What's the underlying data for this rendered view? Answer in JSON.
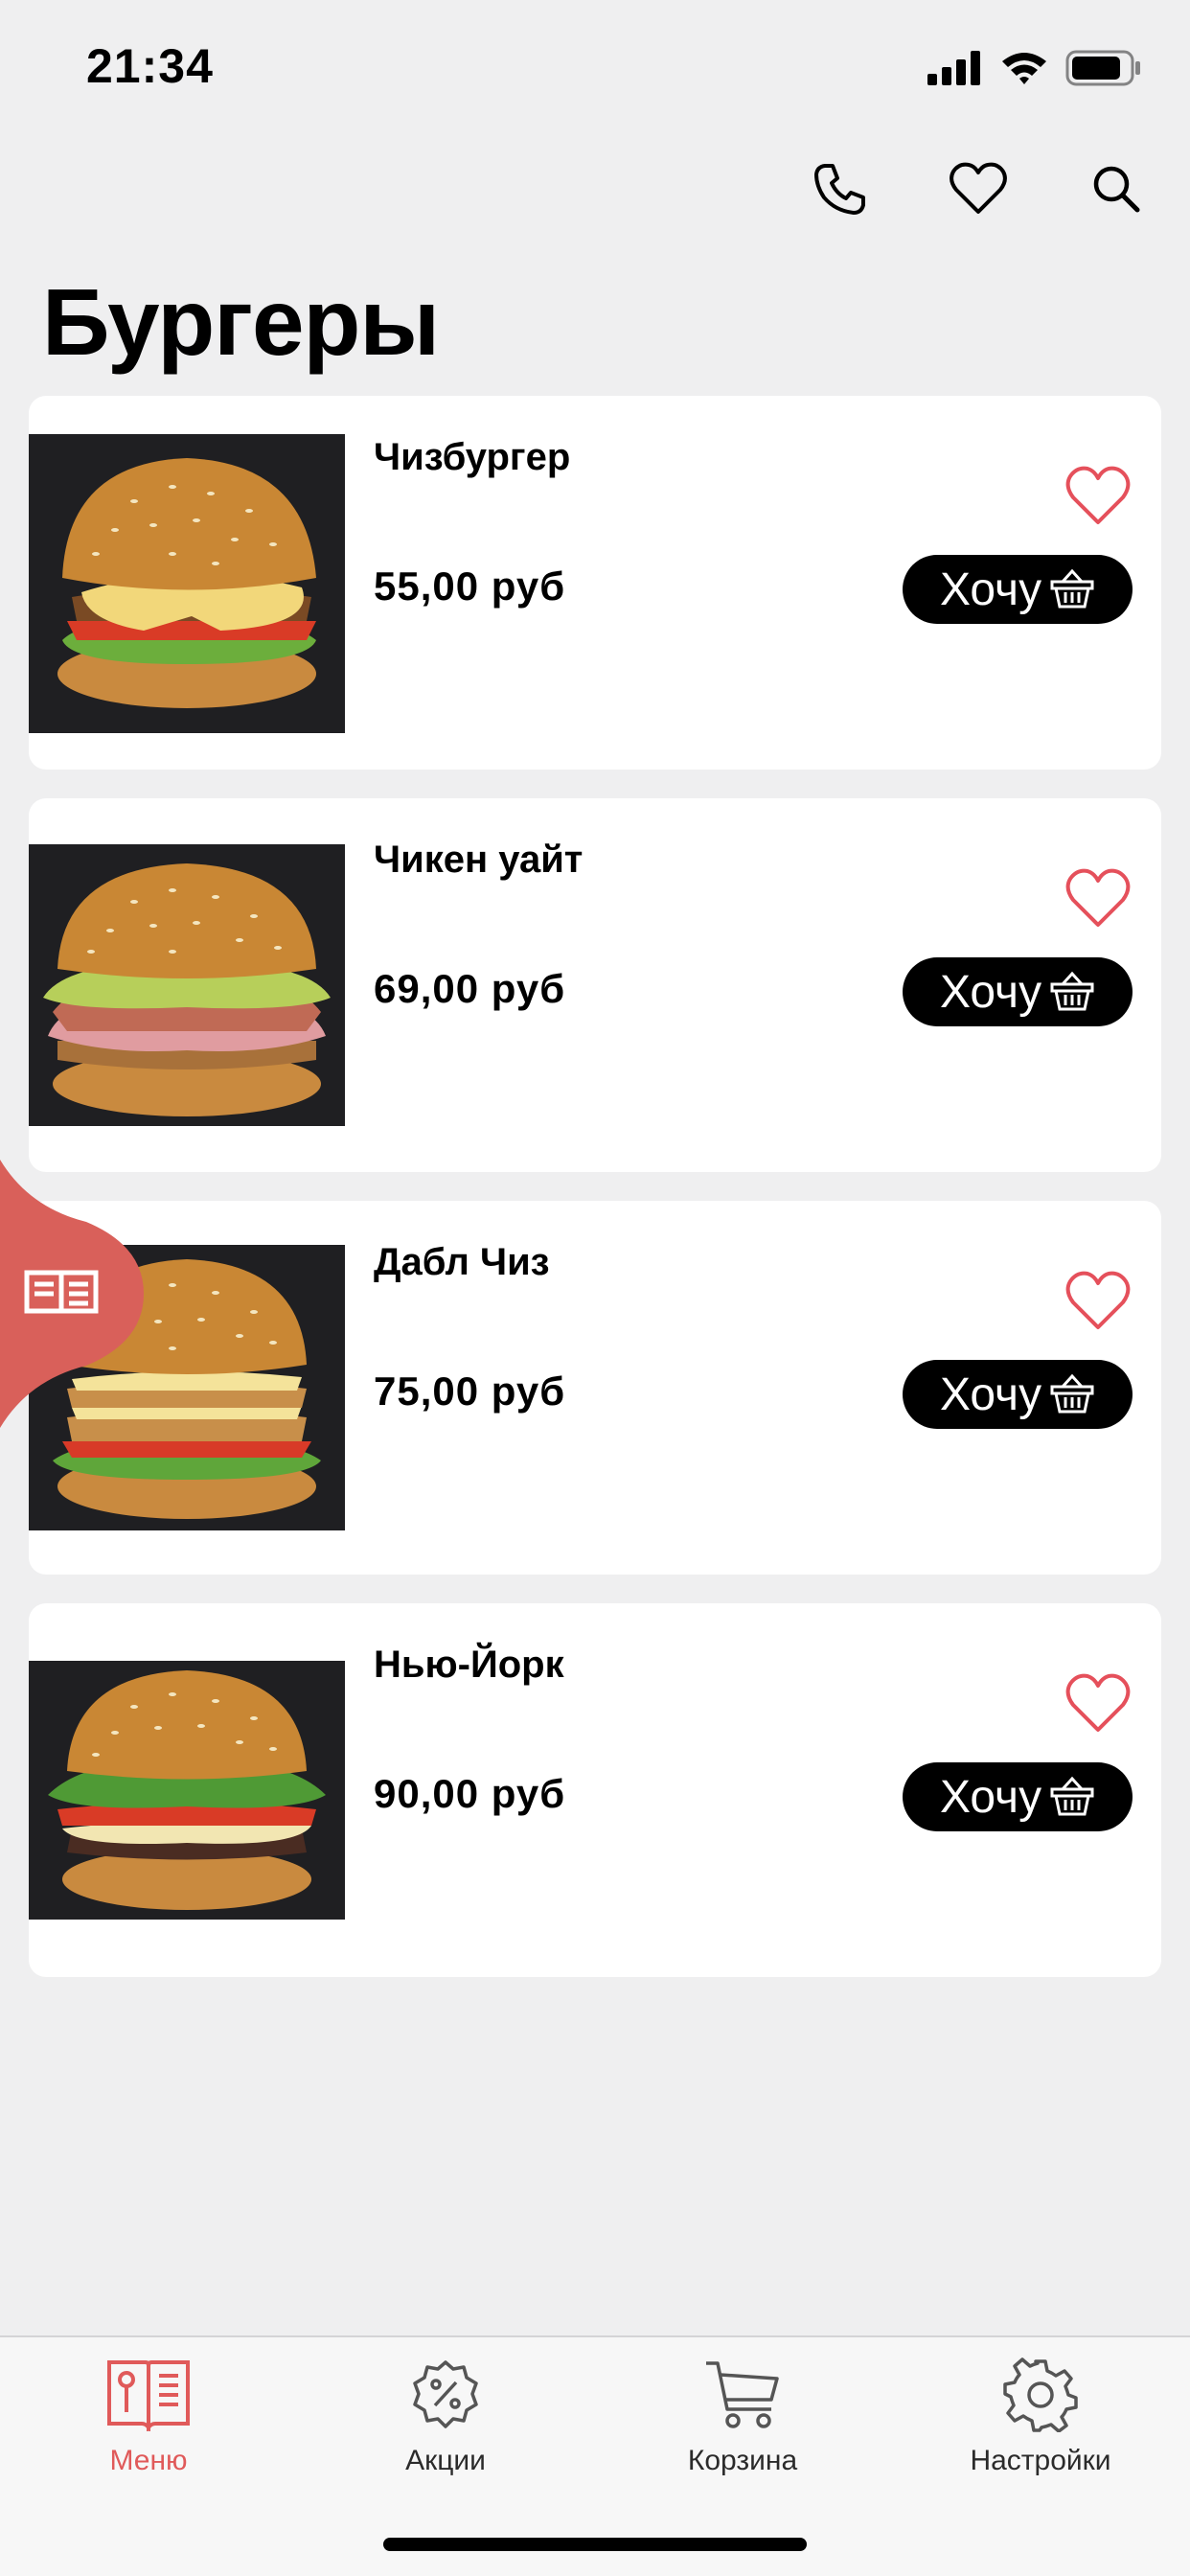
{
  "status_bar": {
    "time": "21:34",
    "icons": [
      "signal-icon",
      "wifi-icon",
      "battery-icon"
    ]
  },
  "header": {
    "title": "Бургеры",
    "actions": [
      "phone-icon",
      "heart-icon",
      "search-icon"
    ]
  },
  "products": [
    {
      "name": "Чизбургер",
      "price": "55,00 руб",
      "button": "Хочу"
    },
    {
      "name": "Чикен уайт",
      "price": "69,00 руб",
      "button": "Хочу"
    },
    {
      "name": "Дабл Чиз",
      "price": "75,00 руб",
      "button": "Хочу"
    },
    {
      "name": "Нью-Йорк",
      "price": "90,00 руб",
      "button": "Хочу"
    }
  ],
  "tab_bar": {
    "active": "Меню",
    "tabs": [
      {
        "label": "Меню",
        "icon": "menu-book-icon"
      },
      {
        "label": "Акции",
        "icon": "percent-badge-icon"
      },
      {
        "label": "Корзина",
        "icon": "cart-icon"
      },
      {
        "label": "Настройки",
        "icon": "gear-icon"
      }
    ]
  },
  "colors": {
    "accent": "#e05a5a",
    "button_bg": "#000000",
    "background": "#efeff0",
    "card": "#ffffff"
  }
}
